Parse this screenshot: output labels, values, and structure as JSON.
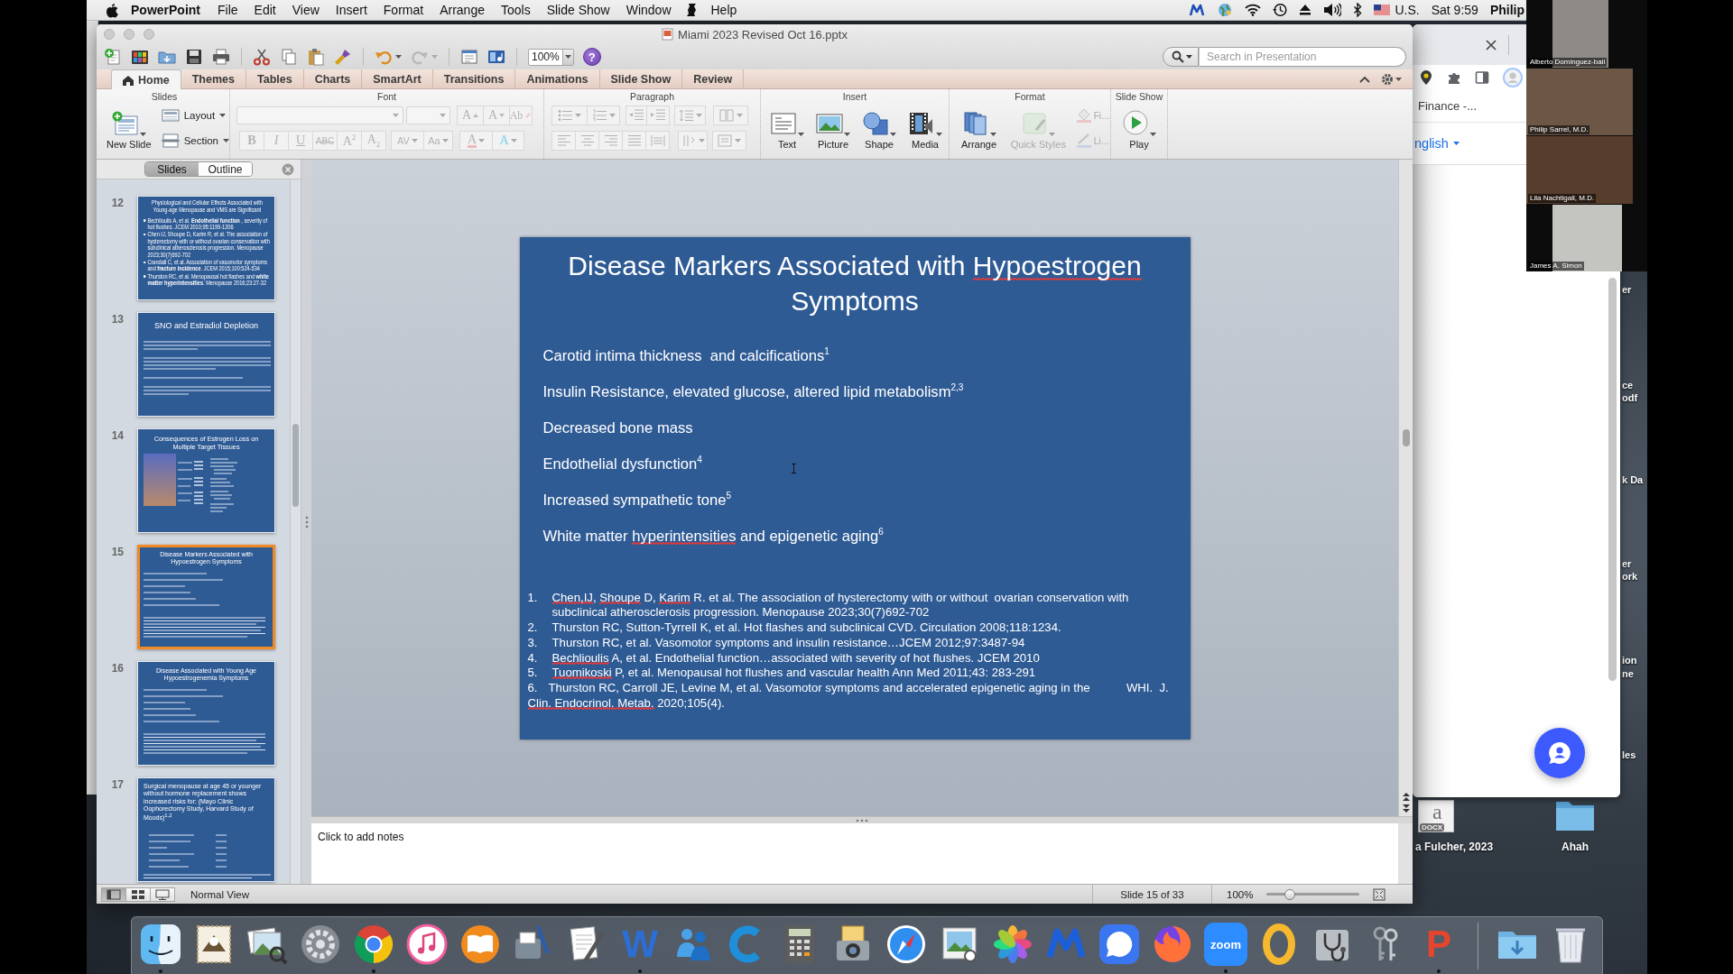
{
  "menu_bar": {
    "app_name": "PowerPoint",
    "menus": [
      {
        "kind": "menu",
        "label": "File"
      },
      {
        "kind": "menu",
        "label": "Edit"
      },
      {
        "kind": "menu",
        "label": "View"
      },
      {
        "kind": "menu",
        "label": "Insert"
      },
      {
        "kind": "menu",
        "label": "Format"
      },
      {
        "kind": "menu",
        "label": "Arrange"
      },
      {
        "kind": "menu",
        "label": "Tools"
      },
      {
        "kind": "menu",
        "label": "Slide Show"
      },
      {
        "kind": "menu",
        "label": "Window"
      },
      {
        "kind": "script"
      },
      {
        "kind": "menu",
        "label": "Help"
      }
    ],
    "input_source": "U.S.",
    "clock": "Sat 9:59",
    "user": "Philip"
  },
  "window": {
    "title": "Miami 2023 Revised Oct 16.pptx"
  },
  "toolbar": {
    "undo": {
      "disabled": false
    },
    "redo": {
      "disabled": true
    },
    "zoom": "100%",
    "help": "?",
    "search": {
      "placeholder": "Search in Presentation"
    }
  },
  "ribbon": {
    "tabs": [
      {
        "label": "Home",
        "selected": true
      },
      {
        "label": "Themes",
        "selected": false
      },
      {
        "label": "Tables",
        "selected": false
      },
      {
        "label": "Charts",
        "selected": false
      },
      {
        "label": "SmartArt",
        "selected": false
      },
      {
        "label": "Transitions",
        "selected": false
      },
      {
        "label": "Animations",
        "selected": false
      },
      {
        "label": "Slide Show",
        "selected": false
      },
      {
        "label": "Review",
        "selected": false
      }
    ],
    "slides_group": {
      "title": "Slides",
      "new_slide": "New Slide",
      "layout": "Layout",
      "section": "Section"
    },
    "font_group": {
      "title": "Font",
      "disabled": true,
      "row_1": [
        {
          "kind": "grow",
          "label": "A"
        },
        {
          "kind": "shrink",
          "label": "A"
        },
        {
          "kind": "clear",
          "label": "Ab"
        }
      ],
      "row_2": [
        {
          "kind": "bold",
          "label": "B"
        },
        {
          "kind": "italic",
          "label": "I"
        },
        {
          "kind": "underline",
          "label": "U"
        },
        {
          "kind": "strike",
          "label": "ABC"
        },
        {
          "kind": "superscript",
          "label": "A$^{2}$"
        },
        {
          "kind": "subscript",
          "label": "A$_{2}$"
        },
        {
          "kind": "spacing",
          "label": "AV"
        },
        {
          "kind": "case",
          "label": "Aa"
        },
        {
          "kind": "color",
          "label": "A"
        },
        {
          "kind": "effects",
          "label": "A"
        }
      ]
    },
    "paragraph_group": {
      "title": "Paragraph",
      "disabled": true
    },
    "insert_group": {
      "title": "Insert",
      "buttons": [
        {
          "kind": "text",
          "label": "Text"
        },
        {
          "kind": "picture",
          "label": "Picture"
        },
        {
          "kind": "shape",
          "label": "Shape"
        },
        {
          "kind": "media",
          "label": "Media"
        }
      ]
    },
    "format_group": {
      "title": "Format",
      "buttons": [
        {
          "kind": "arrange",
          "label": "Arrange",
          "disabled": false
        },
        {
          "kind": "styles",
          "label": "Quick Styles",
          "disabled": true
        }
      ],
      "small_buttons": [
        {
          "kind": "fill",
          "label": "Fi…",
          "disabled": true
        },
        {
          "kind": "line",
          "label": "Li…",
          "disabled": true
        }
      ]
    },
    "slide_show_group": {
      "title": "Slide Show",
      "play": "Play"
    }
  },
  "slides_pane": {
    "tabs": [
      {
        "label": "Slides",
        "selected": true
      },
      {
        "label": "Outline",
        "selected": false
      }
    ],
    "thumbnails": [
      {
        "number": "12",
        "selected": false,
        "kind": "references",
        "title": "Physiological and Cellular Effects Associated with Young-age Menopause and VMS are Significant",
        "bullets": [
          "Bechlioulis A, et al. **Endothelial function** , severity of hot flushes. JCEM 2010;95:1199-1206",
          "Chen IJ, Shoupe D, Karim R, et al. The association of hysterectomy with or without ovarian conservation with subclinical atherosclerosis progression. Menopause 2023;30(7)692-702",
          "Crandall C, et al. Association of vasomotor symptoms and **fracture incidence**. JCEM 2015;100:524-534",
          "Thurston RC, et al. Menopausal hot flashes and **white matter hyperintensities**. Menopause 2016;23:27-32"
        ]
      },
      {
        "number": "13",
        "selected": false,
        "kind": "text",
        "title": "SNO and Estradiol Depletion"
      },
      {
        "number": "14",
        "selected": false,
        "kind": "figure",
        "title": "Consequences of Estrogen Loss on Multiple Target Tissues"
      },
      {
        "number": "15",
        "selected": true,
        "kind": "list",
        "title": "Disease Markers Associated with Hypoestrogen Symptoms"
      },
      {
        "number": "16",
        "selected": false,
        "kind": "list",
        "title": "Disease Associated with Young Age Hypoestrogenemia Symptoms"
      },
      {
        "number": "17",
        "selected": false,
        "kind": "table",
        "title": "Surgical menopause at age 45 or younger without hormone replacement shows increased risks for: (Mayo Clinic Oophorectomy Study, Harvard Study of Moods)$^{1,2}$"
      }
    ]
  },
  "slide": {
    "title": [
      {
        "text": "Disease Markers Associated with ",
        "misspelled": false
      },
      {
        "text": "Hypoestrogen",
        "misspelled": true
      },
      {
        "text": " Symptoms",
        "misspelled": false
      }
    ],
    "bullets": [
      [
        {
          "text": "Carotid intima thickness  and calcifications$^{1}$",
          "misspelled": false
        }
      ],
      [
        {
          "text": "Insulin Resistance, elevated glucose, altered lipid metabolism$^{2,3}$",
          "misspelled": false
        }
      ],
      [
        {
          "text": "Decreased bone mass",
          "misspelled": false
        }
      ],
      [
        {
          "text": "Endothelial dysfunction$^{4}$",
          "misspelled": false
        }
      ],
      [
        {
          "text": "Increased sympathetic tone$^{5}$",
          "misspelled": false
        }
      ],
      [
        {
          "text": "White matter ",
          "misspelled": false
        },
        {
          "text": "hyperintensities",
          "misspelled": true
        },
        {
          "text": " and epigenetic aging$^{6}$",
          "misspelled": false
        }
      ]
    ],
    "references": [
      {
        "number": "1.",
        "kind": "hanging",
        "text": [
          {
            "text": "Chen,IJ",
            "misspelled": true
          },
          {
            "text": ", ",
            "misspelled": false
          },
          {
            "text": "Shoupe",
            "misspelled": true
          },
          {
            "text": " D, ",
            "misspelled": false
          },
          {
            "text": "Karim",
            "misspelled": true
          },
          {
            "text": " R. et al. The association of hysterectomy with or without  ovarian conservation with subclinical atherosclerosis progression. Menopause 2023;30(7)692-702",
            "misspelled": false
          }
        ]
      },
      {
        "number": "2.",
        "kind": "hanging",
        "text": [
          {
            "text": "Thurston RC, Sutton-Tyrrell K, et al. Hot flashes and subclinical CVD. Circulation 2008;118:1234.",
            "misspelled": false
          }
        ]
      },
      {
        "number": "3.",
        "kind": "hanging",
        "text": [
          {
            "text": "Thurston RC, et al. Vasomotor symptoms and insulin resistance…JCEM 2012;97:3487-94",
            "misspelled": false
          }
        ]
      },
      {
        "number": "4.",
        "kind": "hanging",
        "text": [
          {
            "text": "Bechlioulis",
            "misspelled": true
          },
          {
            "text": " A, et al. Endothelial function…associated with severity of hot flushes. JCEM 2010",
            "misspelled": false
          }
        ]
      },
      {
        "number": "5.",
        "kind": "hanging",
        "text": [
          {
            "text": "Tuomikoski",
            "misspelled": true
          },
          {
            "text": " P, et al. Menopausal hot flushes and vascular health Ann Med 2011;43: 283-291",
            "misspelled": false
          }
        ]
      },
      {
        "number": "6.",
        "kind": "inline",
        "text": [
          {
            "text": "Thurston RC, Carroll JE, Levine M, et al. Vasomotor symptoms and accelerated epigenetic aging in the           WHI.  J. ",
            "misspelled": false
          },
          {
            "text": "Clin. Endocrinol. Metab.",
            "misspelled": true
          },
          {
            "text": " 2020;105(4).",
            "misspelled": false
          }
        ]
      }
    ]
  },
  "notes": {
    "placeholder": "Click to add notes"
  },
  "status_bar": {
    "views": [
      {
        "kind": "normal",
        "selected": true
      },
      {
        "kind": "sorter",
        "selected": false
      },
      {
        "kind": "presenter",
        "selected": false
      }
    ],
    "view_name": "Normal View",
    "slide_position": "Slide 15 of 33",
    "zoom": "100%",
    "zoom_slider": {
      "level": 0.25
    }
  },
  "browser": {
    "bookmark": "Finance -...",
    "language": "nglish"
  },
  "desktop": {
    "icons": [
      {
        "kind": "document",
        "letter": "a",
        "badge": "DOCX",
        "label": "a Fulcher, 2023"
      },
      {
        "kind": "folder",
        "label": "Ahah"
      }
    ],
    "label_fragments": [
      "er",
      "ce",
      "odf",
      "k Da",
      "er",
      "ork",
      "ion",
      "ne",
      "les"
    ]
  },
  "video_call": {
    "participants": [
      {
        "name": "Alberto Dominguez-bali"
      },
      {
        "name": "Philip Sarrel, M.D."
      },
      {
        "name": "Lila Nachtigall, M.D."
      },
      {
        "name": "James A. Simon"
      }
    ]
  },
  "dock": {
    "apps": [
      {
        "kind": "finder",
        "running": true
      },
      {
        "kind": "stamp",
        "running": false
      },
      {
        "kind": "photos",
        "running": false
      },
      {
        "kind": "gear",
        "running": false
      },
      {
        "kind": "chrome",
        "running": true
      },
      {
        "kind": "music",
        "running": false
      },
      {
        "kind": "book",
        "running": false
      },
      {
        "kind": "mailbox",
        "running": false
      },
      {
        "kind": "pen",
        "running": false
      },
      {
        "kind": "letter",
        "label": "W",
        "color": "#2b6fd6",
        "running": true
      },
      {
        "kind": "people",
        "running": false
      },
      {
        "kind": "crescent",
        "running": false
      },
      {
        "kind": "calculator",
        "running": false
      },
      {
        "kind": "camera",
        "running": false
      },
      {
        "kind": "compass",
        "running": false
      },
      {
        "kind": "frame",
        "running": false
      },
      {
        "kind": "flower",
        "running": false
      },
      {
        "kind": "zigzag",
        "running": false
      },
      {
        "kind": "bubble",
        "running": false
      },
      {
        "kind": "firefox",
        "running": false
      },
      {
        "kind": "tile",
        "label": "zoom",
        "running": true
      },
      {
        "kind": "ring",
        "running": false
      },
      {
        "kind": "stethoscope",
        "running": false
      },
      {
        "kind": "keys",
        "running": false
      },
      {
        "kind": "letter",
        "label": "P",
        "color": "#e5452d",
        "running": true
      }
    ],
    "stacks": [
      {
        "kind": "folder"
      },
      {
        "kind": "trash"
      }
    ]
  }
}
